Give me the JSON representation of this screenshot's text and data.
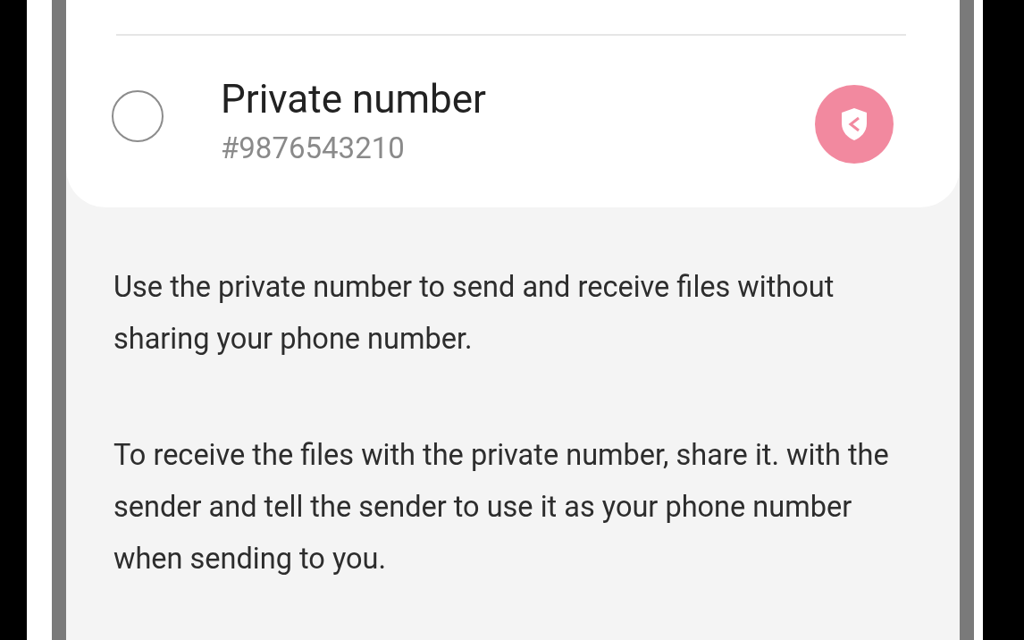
{
  "option": {
    "title": "Private number",
    "number": "#9876543210",
    "selected": false
  },
  "paragraphs": [
    "Use the private number to send and receive files without sharing your phone number.",
    "To receive the files with the private number, share it. with the sender and tell the sender to use it as your phone number when sending to you."
  ]
}
